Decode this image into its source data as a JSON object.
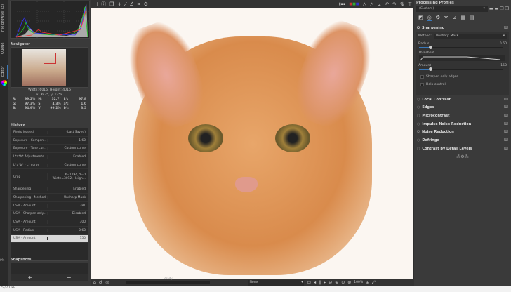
{
  "vtabs": {
    "file_browser": "File Browser (3)",
    "queue": "Queue",
    "editor": "Editor"
  },
  "navigator": {
    "title": "Navigator",
    "size": "Width: 6016, Height: 4016",
    "coords": "x: 3975, y: 1258",
    "values": [
      [
        "R:",
        "99.2%"
      ],
      [
        "H:",
        "32.7°"
      ],
      [
        "L*:",
        "97.8"
      ],
      [
        "G:",
        "97.3%"
      ],
      [
        "S:",
        "4.3%"
      ],
      [
        "a*:",
        "1.0"
      ],
      [
        "B:",
        "94.9%"
      ],
      [
        "V:",
        "99.2%"
      ],
      [
        "b*:",
        "3.5"
      ]
    ]
  },
  "history": {
    "title": "History",
    "rows": [
      [
        "Photo loaded",
        "(Last Saved)"
      ],
      [
        "Exposure - Compen...",
        "1.60"
      ],
      [
        "Exposure - Tone cur...",
        "Custom curve"
      ],
      [
        "L*a*b* Adjustments",
        "Enabled"
      ],
      [
        "L*a*b* - L* curve",
        "Custom curve"
      ],
      [
        "Crop",
        "X=1294, Y=0 Width=3012, Heigh..."
      ],
      [
        "Sharpening",
        "Enabled"
      ],
      [
        "Sharpening - Method",
        "Unsharp Mask"
      ],
      [
        "USM - Amount",
        "381"
      ],
      [
        "USM - Sharpen only...",
        "Disabled"
      ],
      [
        "USM - Amount",
        "300"
      ],
      [
        "USM - Radius",
        "0.60"
      ],
      [
        "USM - Amount",
        "150"
      ]
    ]
  },
  "snapshots": {
    "title": "Snapshots",
    "add": "+",
    "remove": "−"
  },
  "zoom_left": "0%",
  "bottom": {
    "status": "Ready",
    "profile": "None",
    "zoom": "100%"
  },
  "right": {
    "profiles_title": "Processing Profiles",
    "profile": "(Custom)",
    "sharpening": {
      "title": "Sharpening",
      "method_label": "Method:",
      "method": "Unsharp Mask",
      "radius_label": "Radius",
      "radius": "0.60",
      "radius_frac": 0.15,
      "threshold_label": "Threshold",
      "amount_label": "Amount",
      "amount": "150",
      "amount_frac": 0.15,
      "edges_only": "Sharpen only edges",
      "halo": "Halo control"
    },
    "tools": [
      "Local Contrast",
      "Edges",
      "Microcontrast",
      "Impulse Noise Reduction",
      "Noise Reduction",
      "Defringe",
      "Contrast by Detail Levels"
    ]
  },
  "statusbar": "5 / 41 kB"
}
